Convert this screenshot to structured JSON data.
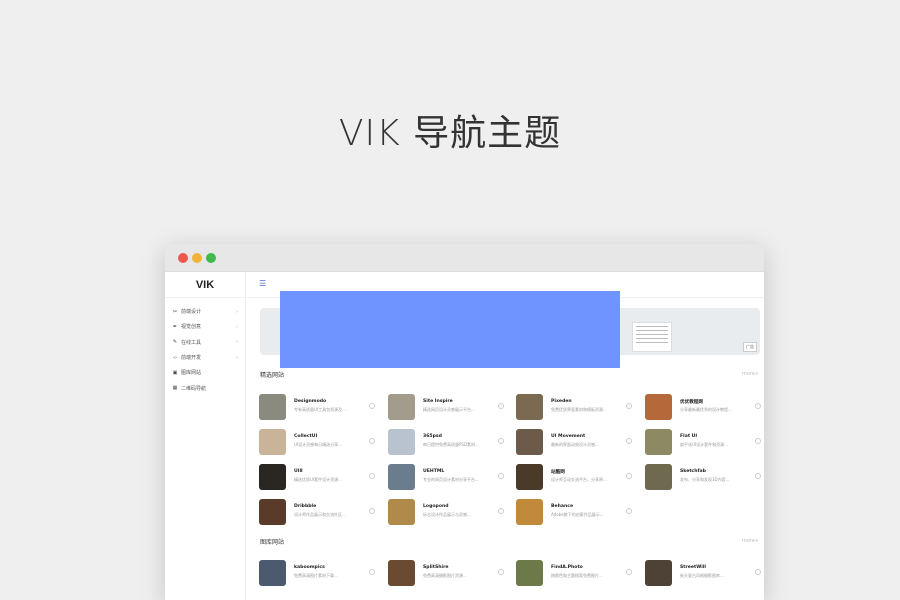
{
  "hero": {
    "title": "VIK 导航主题"
  },
  "logo": "VIK",
  "sidebar": {
    "items": [
      {
        "label": "前端设计",
        "icon": "scissors-icon",
        "arrow": "›"
      },
      {
        "label": "视觉创意",
        "icon": "pen-nib-icon",
        "arrow": "›"
      },
      {
        "label": "在线工具",
        "icon": "pencil-icon",
        "arrow": "›"
      },
      {
        "label": "前端开发",
        "icon": "code-icon",
        "arrow": "›"
      },
      {
        "label": "图库网站",
        "icon": "image-icon",
        "arrow": ""
      },
      {
        "label": "二维码导航",
        "icon": "grid-icon",
        "arrow": ""
      }
    ]
  },
  "banner": {
    "ad_tag": "广告"
  },
  "sections": [
    {
      "title": "精选网站",
      "more": "more+"
    },
    {
      "title": "图库网站",
      "more": "more+"
    }
  ],
  "featured_sites": [
    {
      "name": "Designmodo",
      "desc": "专有高质量UI工具包资源及...",
      "thumb": "#8a8a7e"
    },
    {
      "name": "Site Inspire",
      "desc": "精选网页设计灵感展示平台...",
      "thumb": "#a39b8c"
    },
    {
      "name": "Pixeden",
      "desc": "免费优质界面素材和模板资源...",
      "thumb": "#7b6a52"
    },
    {
      "name": "优优教程网",
      "desc": "分享最新最优秀的设计教程...",
      "thumb": "#b5683a"
    },
    {
      "name": "CollectUI",
      "desc": "UI设计灵感每日精选分享...",
      "thumb": "#c9b49a"
    },
    {
      "name": "365psd",
      "desc": "每日提供免费高质量PSD素材...",
      "thumb": "#b8c3cf"
    },
    {
      "name": "UI Movement",
      "desc": "最新的界面动效设计灵感...",
      "thumb": "#6c5a4a"
    },
    {
      "name": "Flat UI",
      "desc": "扁平化UI设计套件和资源...",
      "thumb": "#8d8a63"
    },
    {
      "name": "UI8",
      "desc": "精选优质UI套件设计资源...",
      "thumb": "#2a2622"
    },
    {
      "name": "UEHTML",
      "desc": "专业的网页设计素材分享平台...",
      "thumb": "#6b7c8c"
    },
    {
      "name": "站酷网",
      "desc": "设计师互动交流平台，分享原...",
      "thumb": "#4a3a2a"
    },
    {
      "name": "Sketchfab",
      "desc": "发布、分享和发现3D内容...",
      "thumb": "#6f6a4f"
    },
    {
      "name": "Dribbble",
      "desc": "设计师作品展示和交流社区...",
      "thumb": "#5a3a28"
    },
    {
      "name": "Logopond",
      "desc": "标志设计作品展示与灵感...",
      "thumb": "#b08a4a"
    },
    {
      "name": "Behance",
      "desc": "Adobe旗下的创意作品展示...",
      "thumb": "#c08a3a"
    }
  ],
  "gallery_sites": [
    {
      "name": "kaboompics",
      "desc": "免费高清图片素材下载...",
      "thumb": "#4c5a70"
    },
    {
      "name": "SplitShire",
      "desc": "免费高清摄影图片资源...",
      "thumb": "#6b4a32"
    },
    {
      "name": "FindA.Photo",
      "desc": "按颜色和主题搜索免费图片...",
      "thumb": "#6c7a4a"
    },
    {
      "name": "StreetWill",
      "desc": "街头复古风格摄影图库...",
      "thumb": "#4e4236"
    }
  ]
}
